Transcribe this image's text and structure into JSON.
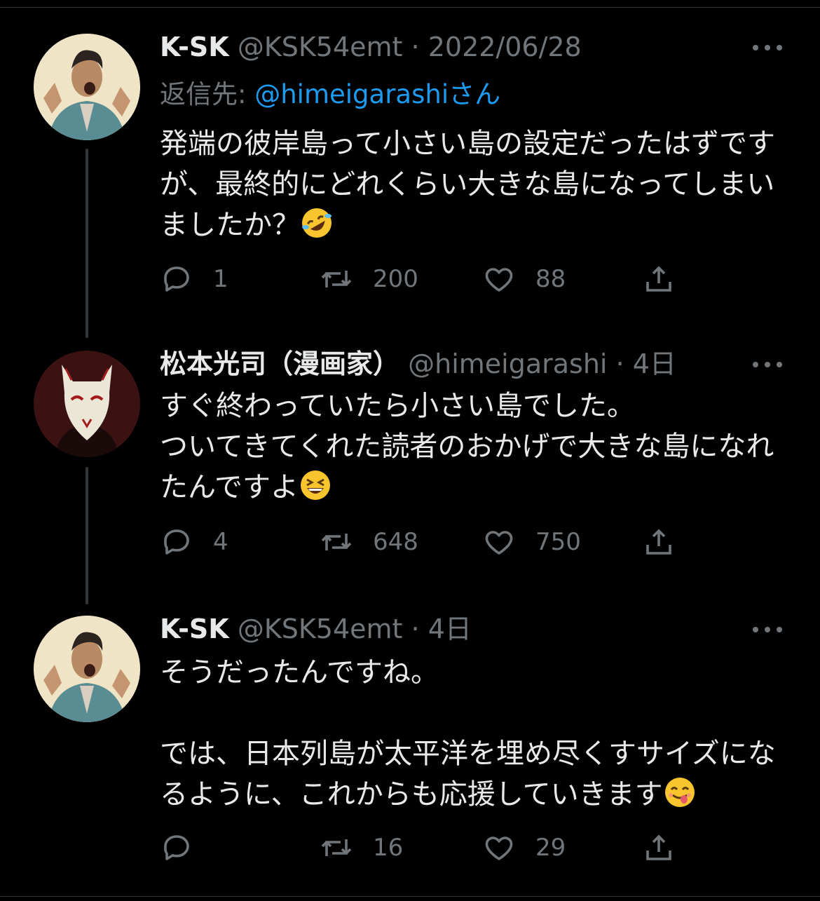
{
  "tweets": [
    {
      "name": "K-SK",
      "handle": "@KSK54emt",
      "separator": "·",
      "date": "2022/06/28",
      "reply_label": "返信先: ",
      "reply_mention": "@himeigarashi",
      "reply_suffix": "さん",
      "text_main": "発端の彼岸島って小さい島の設定だったはずですが、最終的にどれくらい大きな島になってしまいましたか？",
      "emoji": "rofl",
      "replies": "1",
      "retweets": "200",
      "likes": "88"
    },
    {
      "name": "松本光司（漫画家）",
      "handle": "@himeigarashi",
      "separator": "·",
      "date": "4日",
      "text_main": "すぐ終わっていたら小さい島でした。\nついてきてくれた読者のおかげで大きな島になれたんですよ",
      "emoji": "grinning-squinting",
      "replies": "4",
      "retweets": "648",
      "likes": "750"
    },
    {
      "name": "K-SK",
      "handle": "@KSK54emt",
      "separator": "·",
      "date": "4日",
      "text_main": "そうだったんですね。\n\nでは、日本列島が太平洋を埋め尽くすサイズになるように、これからも応援していきます",
      "emoji": "savoring-food",
      "replies": "",
      "retweets": "16",
      "likes": "29"
    }
  ],
  "icons": [
    "reply-icon",
    "retweet-icon",
    "like-icon",
    "share-icon",
    "more-icon"
  ],
  "colors": {
    "background": "#000000",
    "text": "#e7e9ea",
    "muted": "#71767b",
    "link": "#1d9bf0"
  }
}
